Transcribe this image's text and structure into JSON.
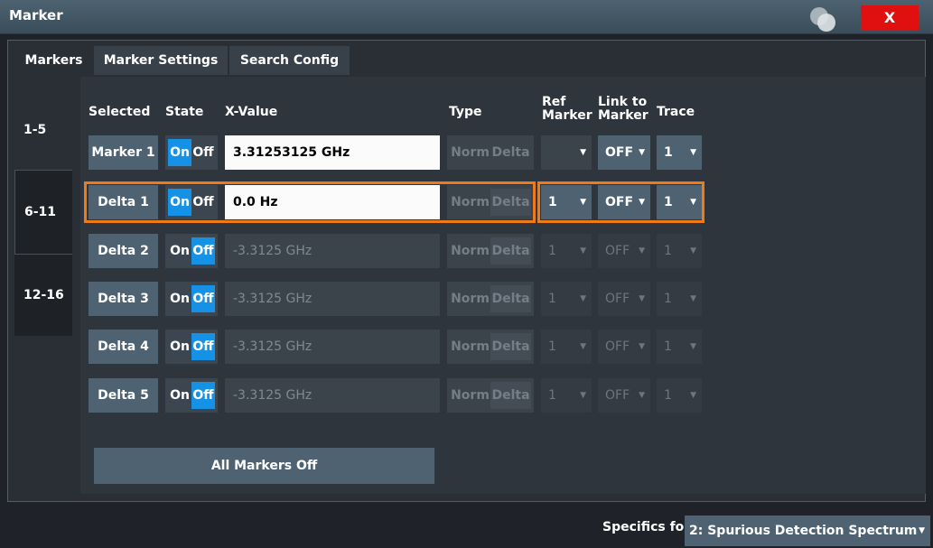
{
  "window": {
    "title": "Marker",
    "close_label": "X"
  },
  "tabs": [
    {
      "label": "Markers",
      "active": true
    },
    {
      "label": "Marker Settings",
      "active": false
    },
    {
      "label": "Search Config",
      "active": false
    }
  ],
  "range_tabs": [
    {
      "label": "1-5",
      "active": false
    },
    {
      "label": "6-11",
      "active": true
    },
    {
      "label": "12-16",
      "active": false
    }
  ],
  "headers": {
    "selected": "Selected",
    "state": "State",
    "x_value": "X-Value",
    "type": "Type",
    "ref_marker_1": "Ref",
    "ref_marker_2": "Marker",
    "link_1": "Link to",
    "link_2": "Marker",
    "trace": "Trace"
  },
  "state_labels": {
    "on": "On",
    "off": "Off"
  },
  "type_labels": {
    "norm": "Norm",
    "delta": "Delta"
  },
  "rows": [
    {
      "name": "Marker 1",
      "state": "On",
      "x_value": "3.31253125 GHz",
      "ref_marker": "",
      "link": "OFF",
      "trace": "1",
      "enabled": true,
      "selected": false
    },
    {
      "name": "Delta 1",
      "state": "On",
      "x_value": "0.0 Hz",
      "ref_marker": "1",
      "link": "OFF",
      "trace": "1",
      "enabled": true,
      "selected": true
    },
    {
      "name": "Delta 2",
      "state": "Off",
      "x_value": "-3.3125 GHz",
      "ref_marker": "1",
      "link": "OFF",
      "trace": "1",
      "enabled": false,
      "selected": false
    },
    {
      "name": "Delta 3",
      "state": "Off",
      "x_value": "-3.3125 GHz",
      "ref_marker": "1",
      "link": "OFF",
      "trace": "1",
      "enabled": false,
      "selected": false
    },
    {
      "name": "Delta 4",
      "state": "Off",
      "x_value": "-3.3125 GHz",
      "ref_marker": "1",
      "link": "OFF",
      "trace": "1",
      "enabled": false,
      "selected": false
    },
    {
      "name": "Delta 5",
      "state": "Off",
      "x_value": "-3.3125 GHz",
      "ref_marker": "1",
      "link": "OFF",
      "trace": "1",
      "enabled": false,
      "selected": false
    }
  ],
  "all_markers_off": "All Markers Off",
  "footer": {
    "label": "Specifics for",
    "value": "2: Spurious Detection Spectrum"
  },
  "colors": {
    "accent_on": "#1591e6",
    "selection": "#f07a16",
    "close": "#e01010"
  }
}
